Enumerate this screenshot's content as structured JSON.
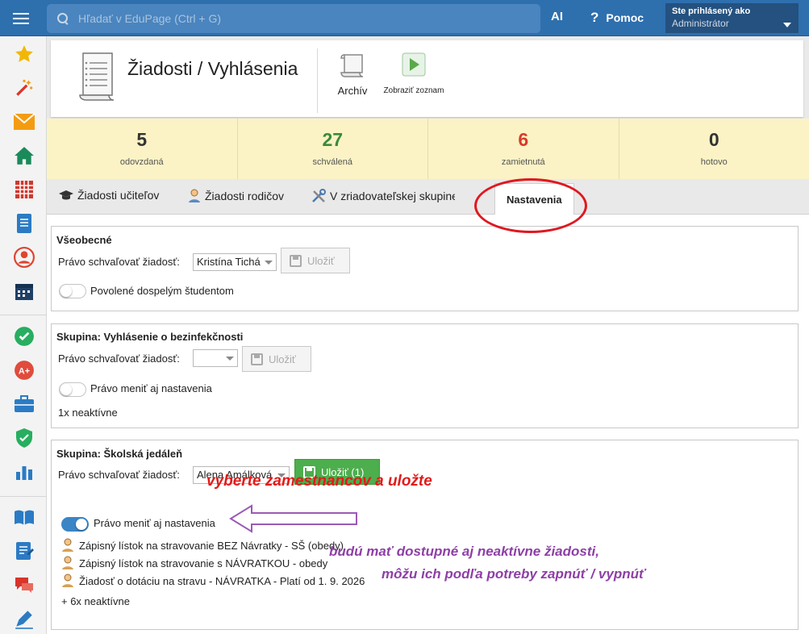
{
  "topbar": {
    "search_placeholder": "Hľadať v EduPage (Ctrl + G)",
    "ai_label": "AI",
    "help_label": "Pomoc",
    "user_line1": "Ste prihlásený ako",
    "user_line2": "Administrátor"
  },
  "header": {
    "title": "Žiadosti / Vyhlásenia",
    "archive_label": "Archív",
    "list_label": "Zobraziť zoznam"
  },
  "stats": [
    {
      "value": "5",
      "label": "odovzdaná",
      "color": "#333333"
    },
    {
      "value": "27",
      "label": "schválená",
      "color": "#3a8a3a"
    },
    {
      "value": "6",
      "label": "zamietnutá",
      "color": "#d83a2a"
    },
    {
      "value": "0",
      "label": "hotovo",
      "color": "#333333"
    }
  ],
  "tabs": {
    "teachers": "Žiadosti učiteľov",
    "parents": "Žiadosti rodičov",
    "founder": "V zriadovateľskej skupine škôl",
    "settings": "Nastavenia"
  },
  "general": {
    "title": "Všeobecné",
    "approve_label": "Právo schvaľovať žiadosť:",
    "approve_value": "Kristína Tichá",
    "save_label": "Uložiť",
    "toggle_label": "Povolené dospelým študentom"
  },
  "group1": {
    "title": "Skupina: Vyhlásenie o bezinfekčnosti",
    "approve_label": "Právo schvaľovať žiadosť:",
    "approve_value": "",
    "save_label": "Uložiť",
    "toggle_label": "Právo meniť aj nastavenia",
    "inactive": "1x neaktívne"
  },
  "group2": {
    "title": "Skupina: Školská jedáleň",
    "approve_label": "Právo schvaľovať žiadosť:",
    "approve_value": "Alena Amálková",
    "save_label": "Uložiť (1)",
    "toggle_label": "Právo meniť aj nastavenia",
    "forms": [
      "Zápisný lístok na stravovanie BEZ Návratky - SŠ (obedy)",
      "Zápisný lístok na stravovanie s NÁVRATKOU - obedy",
      "Žiadosť o dotáciu na stravu - NÁVRATKA - Platí od 1. 9. 2026"
    ],
    "inactive": "+ 6x neaktívne"
  },
  "annotations": {
    "red": "vyberte zamestnancov a uložte",
    "purple_line1": "budú mať dostupné aj neaktívne žiadosti,",
    "purple_line2": "môžu ich podľa potreby zapnúť / vypnúť"
  },
  "sidebar_icons": [
    "star-icon",
    "magic-wand-icon",
    "mail-icon",
    "home-icon",
    "timetable-icon",
    "notebook-icon",
    "user-circle-icon",
    "calendar-icon",
    "check-badge-icon",
    "grade-icon",
    "briefcase-icon",
    "shield-icon",
    "bar-chart-icon",
    "book-icon",
    "document-icon",
    "chat-icon",
    "pen-icon"
  ]
}
